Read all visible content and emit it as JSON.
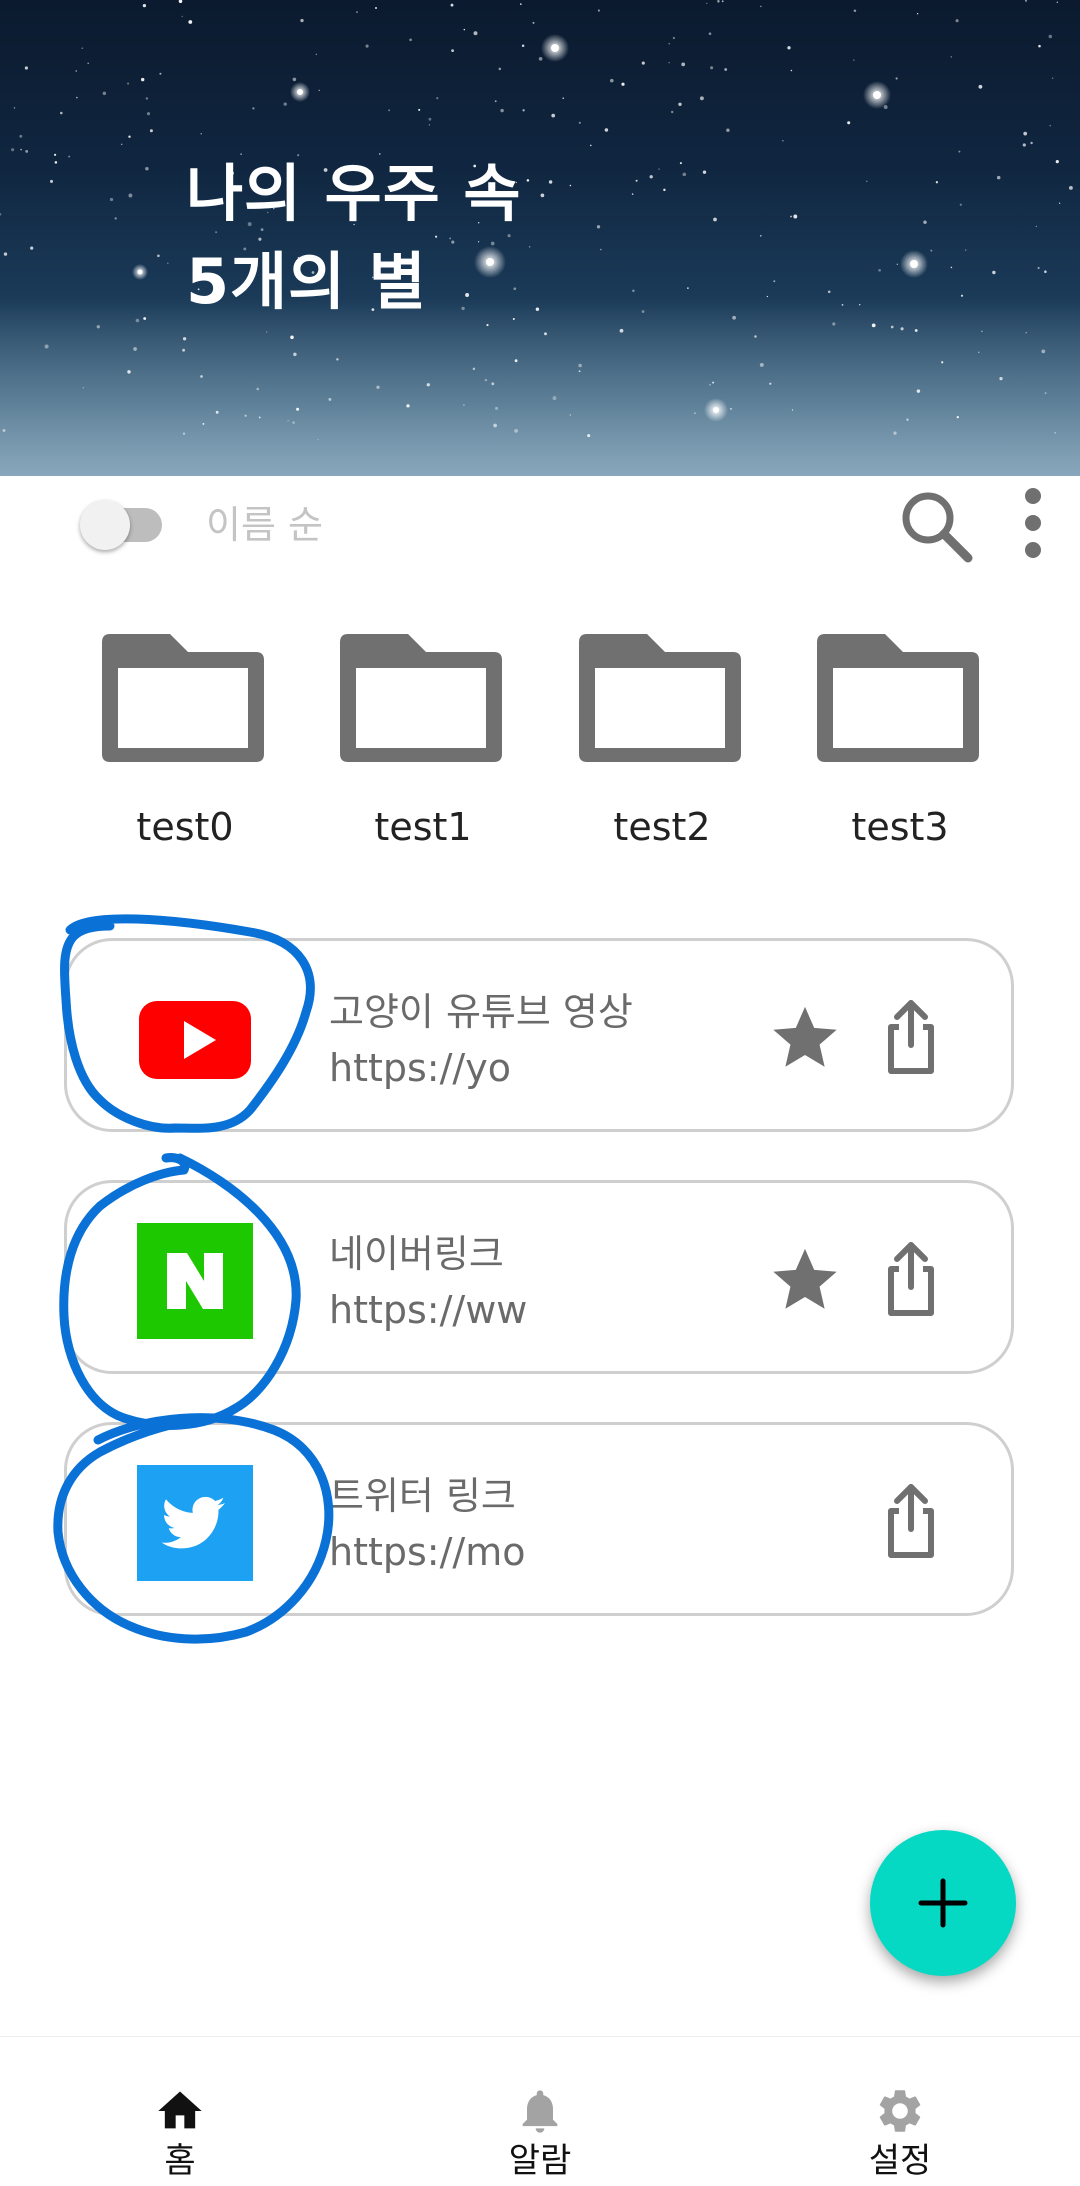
{
  "header": {
    "title_line1": "나의 우주 속",
    "title_line2": "5개의 별"
  },
  "toolbar": {
    "sort_label": "이름 순",
    "sort_toggle_on": false,
    "search_icon": "search-icon",
    "more_icon": "more-vertical-icon"
  },
  "folders": [
    {
      "name": "test0",
      "icon": "folder-icon"
    },
    {
      "name": "test1",
      "icon": "folder-icon"
    },
    {
      "name": "test2",
      "icon": "folder-icon"
    },
    {
      "name": "test3",
      "icon": "folder-icon"
    }
  ],
  "links": [
    {
      "title": "고양이 유튜브 영상",
      "url": "https://yo",
      "logo": "youtube-logo",
      "favorite": true,
      "share_icon": "share-icon"
    },
    {
      "title": "네이버링크",
      "url": "https://ww",
      "logo": "naver-logo",
      "favorite": true,
      "share_icon": "share-icon"
    },
    {
      "title": "트위터 링크",
      "url": "https://mo",
      "logo": "twitter-logo",
      "favorite": false,
      "share_icon": "share-icon"
    }
  ],
  "fab": {
    "icon": "plus-icon"
  },
  "bottom_nav": [
    {
      "label": "홈",
      "icon": "home-icon",
      "active": true
    },
    {
      "label": "알람",
      "icon": "bell-icon",
      "active": false
    },
    {
      "label": "설정",
      "icon": "gear-icon",
      "active": false
    }
  ],
  "colors": {
    "accent": "#05d9c4",
    "annotation_blue": "#0a72d6",
    "youtube_red": "#ff0000",
    "naver_green": "#1ec800",
    "twitter_blue": "#1da1f2",
    "icon_gray": "#707070"
  }
}
